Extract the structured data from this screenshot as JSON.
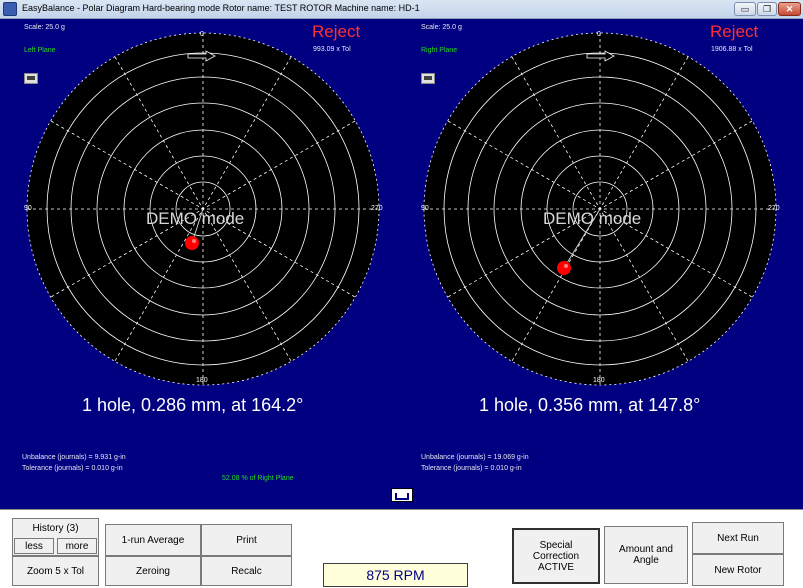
{
  "window": {
    "title": "EasyBalance - Polar Diagram    Hard-bearing mode    Rotor name: TEST ROTOR    Machine name: HD-1",
    "min_label": "▭",
    "max_label": "❐",
    "close_label": "✕"
  },
  "left_plot": {
    "scale": "Scale: 25.0 g",
    "plane": "Left Plane",
    "status": "Reject",
    "tol_ratio": "993.09 x Tol",
    "angle_top": "0",
    "angle_left": "90",
    "angle_right": "270",
    "angle_bottom": "180",
    "demo_text": "DEMO mode",
    "result": "1 hole, 0.286 mm, at 164.2°",
    "unbalance": "Unbalance (journals) = 9.931 g-in",
    "tolerance": "Tolerance (journals)  = 0.010 g-in",
    "percent": "52.08 % of Right Plane"
  },
  "right_plot": {
    "scale": "Scale: 25.0 g",
    "plane": "Right Plane",
    "status": "Reject",
    "tol_ratio": "1906.88 x Tol",
    "angle_top": "0",
    "angle_left": "90",
    "angle_right": "270",
    "angle_bottom": "180",
    "demo_text": "DEMO mode",
    "result": "1 hole, 0.356 mm, at 147.8°",
    "unbalance": "Unbalance (journals) = 19.069 g-in",
    "tolerance": "Tolerance (journals)  = 0.010 g-in"
  },
  "buttons": {
    "history": "History (3)",
    "less": "less",
    "more": "more",
    "one_run_average": "1-run Average",
    "print": "Print",
    "zoom": "Zoom 5 x Tol",
    "zeroing": "Zeroing",
    "recalc": "Recalc",
    "special_correction": "Special Correction ACTIVE",
    "amount_angle": "Amount and Angle",
    "next_run": "Next Run",
    "new_rotor": "New Rotor"
  },
  "rpm": "875 RPM",
  "colors": {
    "background": "#000080",
    "plot_fill": "#000000",
    "reject": "#ff3030",
    "plane_label": "#22dd22",
    "marker": "#ff0000"
  }
}
